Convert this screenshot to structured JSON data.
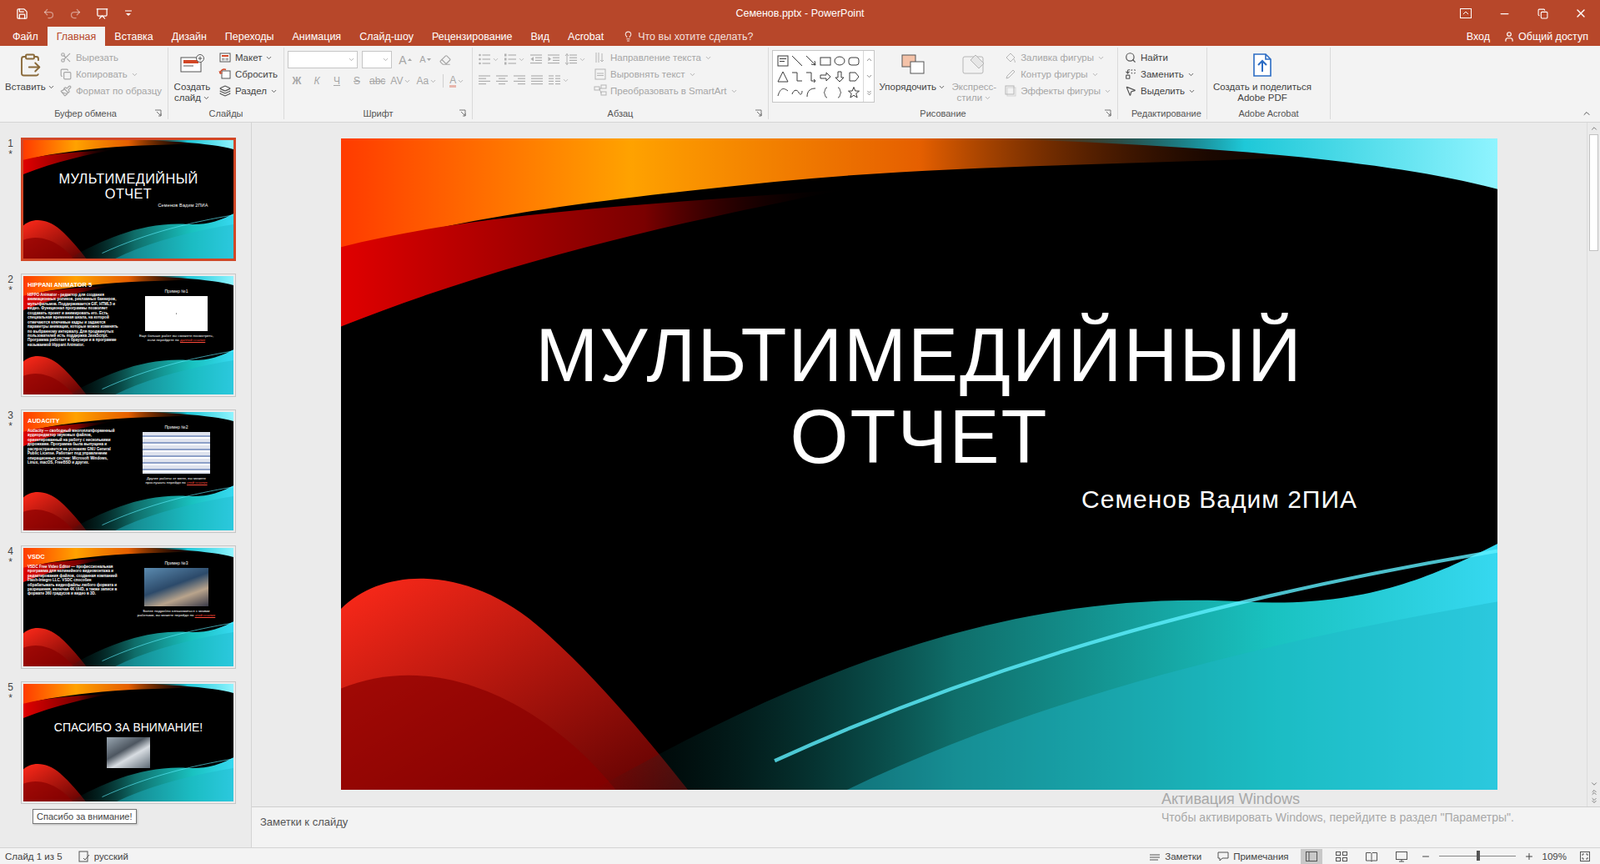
{
  "window": {
    "title": "Семенов.pptx - PowerPoint"
  },
  "quick_access": {
    "undo_disabled": true,
    "redo_disabled": true
  },
  "menu": {
    "tabs": [
      {
        "label": "Файл",
        "selected": false
      },
      {
        "label": "Главная",
        "selected": true
      },
      {
        "label": "Вставка",
        "selected": false
      },
      {
        "label": "Дизайн",
        "selected": false
      },
      {
        "label": "Переходы",
        "selected": false
      },
      {
        "label": "Анимация",
        "selected": false
      },
      {
        "label": "Слайд-шоу",
        "selected": false
      },
      {
        "label": "Рецензирование",
        "selected": false
      },
      {
        "label": "Вид",
        "selected": false
      },
      {
        "label": "Acrobat",
        "selected": false
      }
    ],
    "tell_me": "Что вы хотите сделать?",
    "sign_in": "Вход",
    "share": "Общий доступ"
  },
  "ribbon": {
    "clipboard": {
      "label": "Буфер обмена",
      "paste": {
        "label_lines": [
          "Вставить"
        ],
        "dropdown": true,
        "disabled": false
      },
      "items": [
        {
          "label": "Вырезать",
          "disabled": true,
          "dropdown": false
        },
        {
          "label": "Копировать",
          "disabled": true,
          "dropdown": true
        },
        {
          "label": "Формат по образцу",
          "disabled": true,
          "dropdown": false
        }
      ]
    },
    "slides": {
      "label": "Слайды",
      "new_slide": {
        "label_lines": [
          "Создать",
          "слайд"
        ],
        "dropdown": true,
        "disabled": false
      },
      "items": [
        {
          "label": "Макет",
          "disabled": false,
          "dropdown": true
        },
        {
          "label": "Сбросить",
          "disabled": false,
          "dropdown": false
        },
        {
          "label": "Раздел",
          "disabled": false,
          "dropdown": true
        }
      ]
    },
    "font": {
      "label": "Шрифт",
      "disabled": true,
      "font_name": "",
      "font_size": "",
      "size_glyphs": [
        "A",
        "A"
      ],
      "format_glyphs": [
        "Ж",
        "К",
        "Ч",
        "S",
        "abc",
        "AV",
        "Aa",
        "A"
      ]
    },
    "paragraph": {
      "label": "Абзац",
      "disabled": true,
      "items": [
        {
          "label": "Направление текста",
          "dropdown": true
        },
        {
          "label": "Выровнять текст",
          "dropdown": true
        },
        {
          "label": "Преобразовать в SmartArt",
          "dropdown": true
        }
      ]
    },
    "drawing": {
      "label": "Рисование",
      "large": [
        {
          "label_lines": [
            "Упорядочить"
          ],
          "dropdown": true,
          "disabled": false
        },
        {
          "label_lines": [
            "Экспресс-",
            "стили"
          ],
          "dropdown": true,
          "disabled": true
        }
      ],
      "items": [
        {
          "label": "Заливка фигуры",
          "disabled": true,
          "dropdown": true
        },
        {
          "label": "Контур фигуры",
          "disabled": true,
          "dropdown": true
        },
        {
          "label": "Эффекты фигуры",
          "disabled": true,
          "dropdown": true
        }
      ]
    },
    "editing": {
      "label": "Редактирование",
      "items": [
        {
          "label": "Найти",
          "disabled": false,
          "dropdown": false
        },
        {
          "label": "Заменить",
          "disabled": false,
          "dropdown": true
        },
        {
          "label": "Выделить",
          "disabled": false,
          "dropdown": true
        }
      ]
    },
    "acrobat": {
      "label": "Adobe Acrobat",
      "button": {
        "label_lines": [
          "Создать и поделиться",
          "Adobe PDF"
        ],
        "dropdown": false,
        "disabled": false
      }
    }
  },
  "slides": [
    {
      "number": "1",
      "mark": "*",
      "selected": true,
      "kind": "title",
      "title_lines": [
        "МУЛЬТИМЕДИЙНЫЙ",
        "ОТЧЕТ"
      ],
      "subtitle": "Семенов Вадим 2ПИА"
    },
    {
      "number": "2",
      "mark": "*",
      "selected": false,
      "kind": "content",
      "heading": "HIPPANI ANIMATOR 5",
      "body": "HIPPO Animator - редактор для создания анимационных роликов, рекламных баннеров, мультфильмов. Поддерживается GIF, HTML5 и видео. Функционал программы позволяет создавать проект и анимировать его. Есть специальная временная шкала, на которой отмечаются ключевые кадры и задаются параметры анимации, которые можно изменять по выбранному интервалу. Для продвинутых пользователей есть поддержка JavaScript. Программа работает в браузере и в программе называемой Hippani Animator.",
      "example": "Пример №1",
      "media": "blank",
      "note": "Еще больше работ вы сможете посмотреть, если перейдете по ",
      "link": "данной ссылке"
    },
    {
      "number": "3",
      "mark": "*",
      "selected": false,
      "kind": "content",
      "heading": "AUDACITY",
      "body": "Audacity — свободный многоплатформенный аудиоредактор звуковых файлов, ориентированный на работу с несколькими дорожками. Программа была выпущена и распространяется на условиях GNU General Public License. Работает под управлением операционных систем: Microsoft Windows, Linux, macOS, FreeBSD и других.",
      "example": "Пример №2",
      "media": "screenshot",
      "note": "Другие работы от меня, вы можете прослушать перейдя по ",
      "link": "этой ссылке"
    },
    {
      "number": "4",
      "mark": "*",
      "selected": false,
      "kind": "content",
      "heading": "VSDC",
      "body": "VSDC Free Video Editor — профессиональная программа для нелинейного видеомонтажа и редактирования файлов, созданная компанией Flash-Integro LLC. VSDC способен обрабатывать видеофайлы любого формата и разрешения, включая 4K UHD, а также записи в формате 360 градусов и видео в 3D.",
      "example": "Пример №3",
      "media": "photo",
      "note": "Более подробно ознакомиться с моими работами, вы можете перейдя по ",
      "link": "этой ссылке"
    },
    {
      "number": "5",
      "mark": "*",
      "selected": false,
      "kind": "closing",
      "title": "СПАСИБО ЗА ВНИМАНИЕ!",
      "media": "photo"
    }
  ],
  "tooltip": "Спасибо за внимание!",
  "notes": {
    "placeholder": "Заметки к слайду"
  },
  "status_bar": {
    "slide": "Слайд 1 из 5",
    "language": "русский",
    "notes": "Заметки",
    "comments": "Примечания",
    "views": [
      {
        "selected": true
      },
      {
        "selected": false
      },
      {
        "selected": false
      },
      {
        "selected": false
      }
    ],
    "zoom_level": 0.52,
    "zoom": "109%"
  },
  "watermark": {
    "title": "Активация Windows",
    "text": "Чтобы активировать Windows, перейдите в раздел \"Параметры\"."
  }
}
